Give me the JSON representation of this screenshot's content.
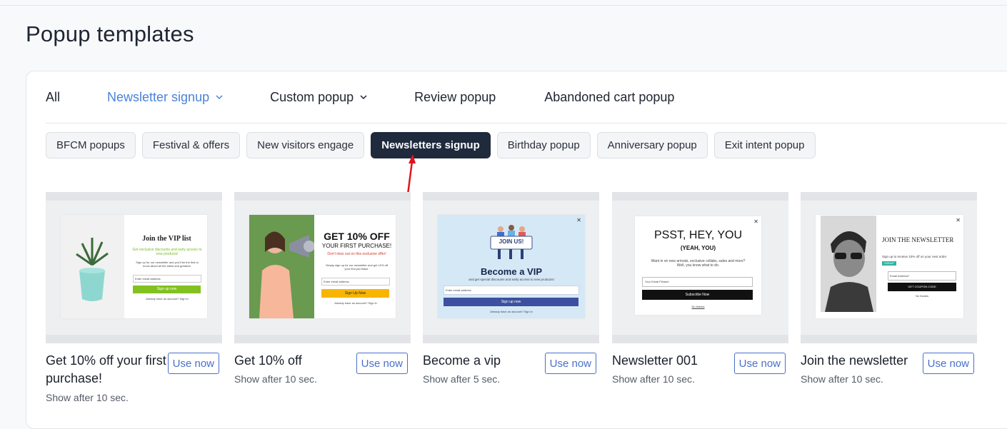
{
  "page": {
    "title": "Popup templates"
  },
  "tabs": [
    {
      "label": "All"
    },
    {
      "label": "Newsletter signup"
    },
    {
      "label": "Custom popup"
    },
    {
      "label": "Review popup"
    },
    {
      "label": "Abandoned cart popup"
    }
  ],
  "chips": [
    {
      "label": "BFCM popups"
    },
    {
      "label": "Festival & offers"
    },
    {
      "label": "New visitors engage"
    },
    {
      "label": "Newsletters signup"
    },
    {
      "label": "Birthday popup"
    },
    {
      "label": "Anniversary popup"
    },
    {
      "label": "Exit intent popup"
    }
  ],
  "colors": {
    "accent": "#4a82d9",
    "active_chip": "#1f2a3d",
    "button": "#4a6fc9",
    "annotation_arrow": "#e0141e"
  },
  "templates": [
    {
      "name": "Get 10% off your first purchase!",
      "subtitle": "Show after 10 sec.",
      "button": "Use now",
      "preview": {
        "heading": "Join the VIP list",
        "highlight": "Get exclusive discounts and early access to new products!",
        "body": "Sign up for our newsletter and you'll be the first to know about all the latest and greatest.",
        "placeholder": "Enter email address",
        "cta": "Sign up now",
        "footer": "Already have an account? Sign in"
      }
    },
    {
      "name": "Get 10% off",
      "subtitle": "Show after 10 sec.",
      "button": "Use now",
      "preview": {
        "heading": "GET 10% OFF",
        "subheading": "YOUR FIRST PURCHASE!",
        "highlight": "Don't miss out on this exclusive offer!",
        "body": "Simply sign up for our newsletter and get 10% off your first purchase.",
        "placeholder": "Enter email address",
        "cta": "Sign Up Now",
        "footer": "Already have an account? Sign in"
      }
    },
    {
      "name": "Become a vip",
      "subtitle": "Show after 5 sec.",
      "button": "Use now",
      "preview": {
        "banner": "JOIN US!",
        "heading": "Become a VIP",
        "body": "and get special discounts and early access to new products!",
        "placeholder": "Enter email address",
        "cta": "Sign up now",
        "footer": "Already have an account? Sign in"
      }
    },
    {
      "name": "Newsletter 001",
      "subtitle": "Show after 10 sec.",
      "button": "Use now",
      "preview": {
        "heading": "PSST, HEY, YOU",
        "subheading": "(YEAH, YOU)",
        "body": "Want in on new arrivals, exclusive collabs, sales and more? Well, you know what to do.",
        "placeholder": "Your Email Please!",
        "cta": "Subscribe Now",
        "footer": "No thanks"
      }
    },
    {
      "name": "Join the newsletter",
      "subtitle": "Show after 10 sec.",
      "button": "Use now",
      "preview": {
        "heading": "JOIN THE NEWSLETTER",
        "body": "Sign up to receive 10% off on your next order",
        "code": "SIGNUP",
        "placeholder": "Email Address*",
        "cta": "GET COUPON CODE",
        "footer": "No thanks"
      }
    }
  ]
}
